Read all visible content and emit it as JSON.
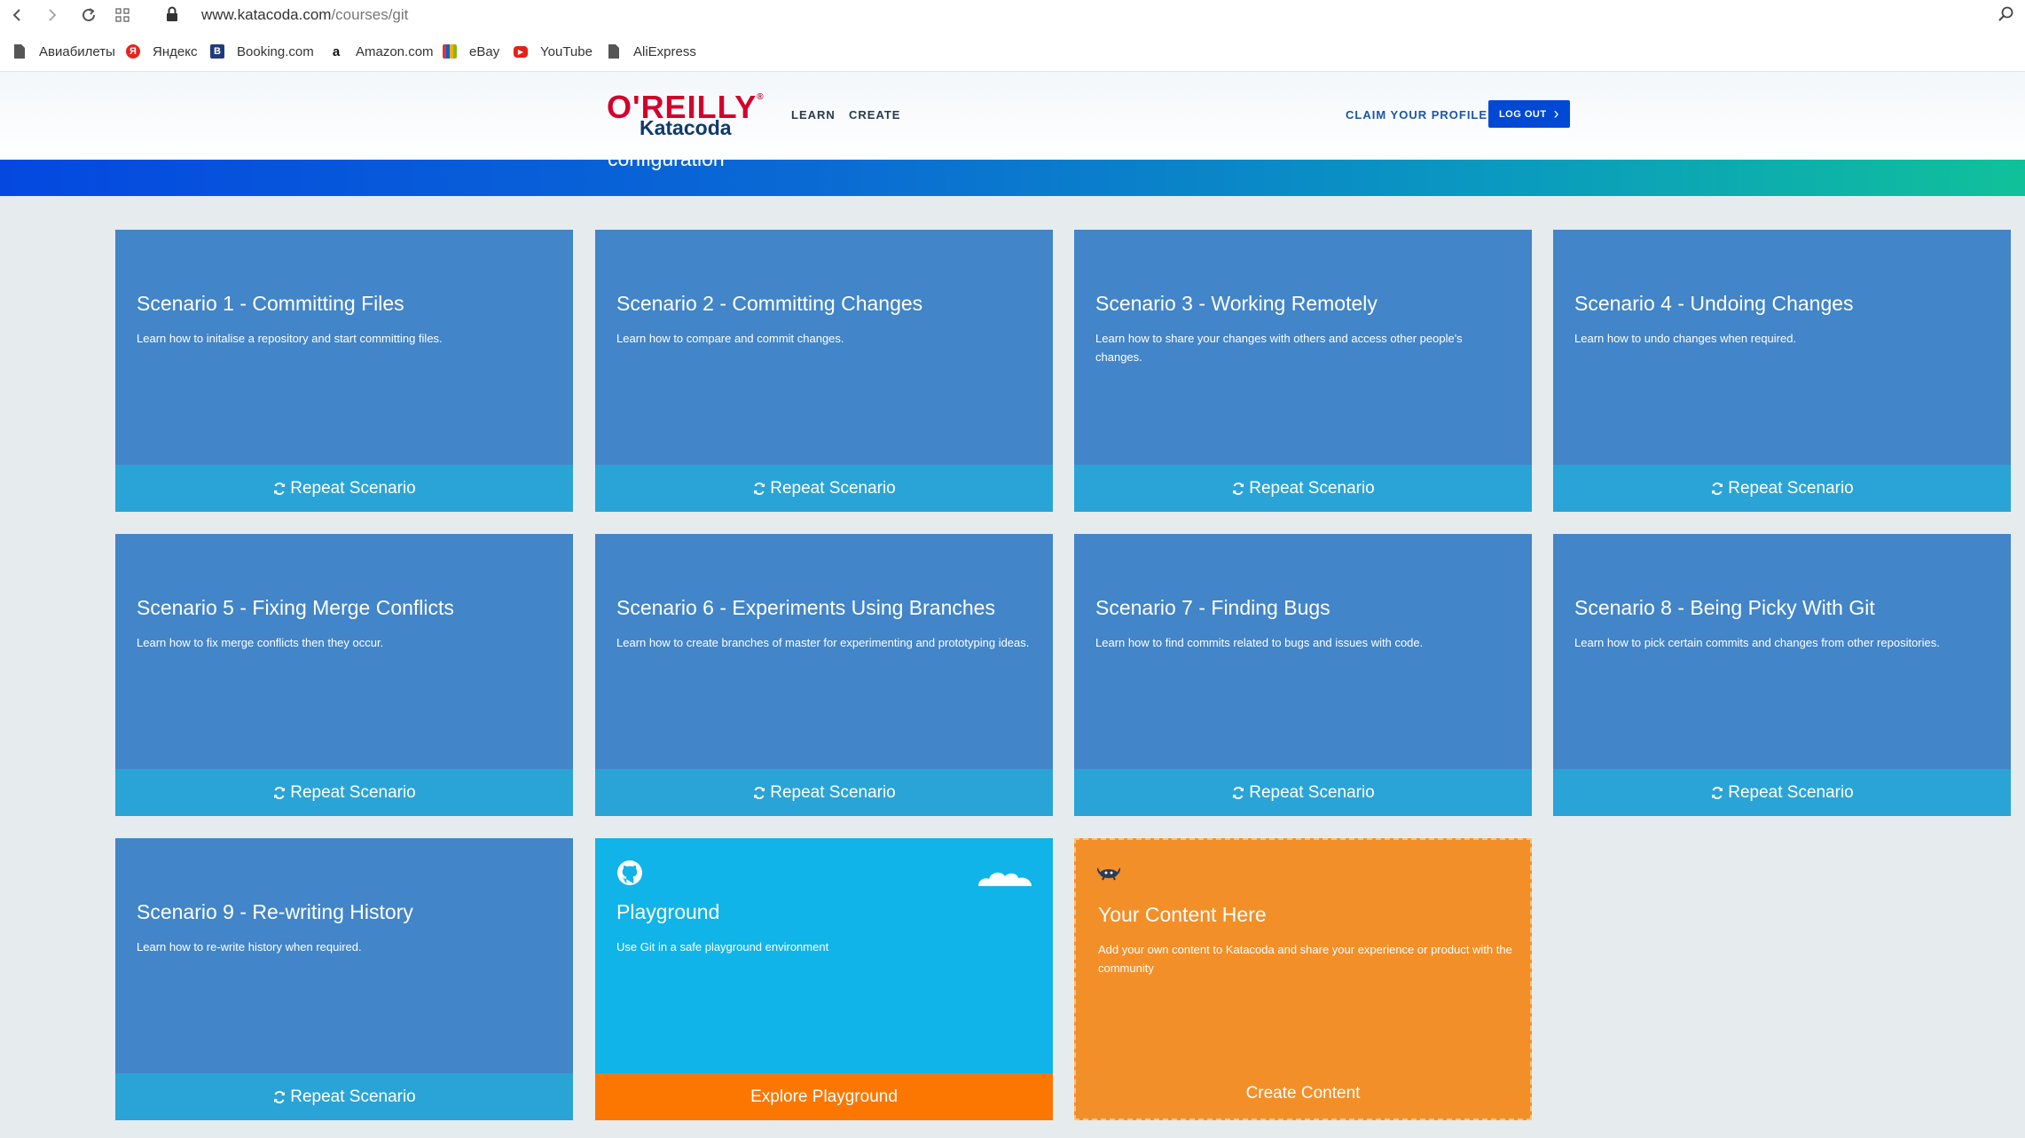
{
  "browser": {
    "url_domain": "www.katacoda.com",
    "url_path": "/courses/git",
    "bookmarks": [
      {
        "label": "Авиабилеты",
        "icon": "file-icon"
      },
      {
        "label": "Яндекс",
        "icon": "yandex-icon"
      },
      {
        "label": "Booking.com",
        "icon": "booking-icon"
      },
      {
        "label": "Amazon.com",
        "icon": "amazon-icon"
      },
      {
        "label": "eBay",
        "icon": "ebay-icon"
      },
      {
        "label": "YouTube",
        "icon": "youtube-icon"
      },
      {
        "label": "AliExpress",
        "icon": "file-icon"
      }
    ]
  },
  "header": {
    "logo_top": "O'REILLY",
    "logo_bottom": "Katacoda",
    "nav": [
      "LEARN",
      "CREATE"
    ],
    "claim": "CLAIM YOUR PROFILE",
    "logout": "LOG OUT"
  },
  "banner": {
    "text": "configuration"
  },
  "cards": [
    {
      "title": "Scenario 1 - Committing Files",
      "desc": "Learn how to initalise a repository and start committing files.",
      "action": "Repeat Scenario"
    },
    {
      "title": "Scenario 2 - Committing Changes",
      "desc": "Learn how to compare and commit changes.",
      "action": "Repeat Scenario"
    },
    {
      "title": "Scenario 3 - Working Remotely",
      "desc": "Learn how to share your changes with others and access other people's changes.",
      "action": "Repeat Scenario"
    },
    {
      "title": "Scenario 4 - Undoing Changes",
      "desc": "Learn how to undo changes when required.",
      "action": "Repeat Scenario"
    },
    {
      "title": "Scenario 5 - Fixing Merge Conflicts",
      "desc": "Learn how to fix merge conflicts then they occur.",
      "action": "Repeat Scenario"
    },
    {
      "title": "Scenario 6 - Experiments Using Branches",
      "desc": "Learn how to create branches of master for experimenting and prototyping ideas.",
      "action": "Repeat Scenario"
    },
    {
      "title": "Scenario 7 - Finding Bugs",
      "desc": "Learn how to find commits related to bugs and issues with code.",
      "action": "Repeat Scenario"
    },
    {
      "title": "Scenario 8 - Being Picky With Git",
      "desc": "Learn how to pick certain commits and changes from other repositories.",
      "action": "Repeat Scenario"
    },
    {
      "title": "Scenario 9 - Re-writing History",
      "desc": "Learn how to re-write history when required.",
      "action": "Repeat Scenario"
    }
  ],
  "playground": {
    "title": "Playground",
    "desc": "Use Git in a safe playground environment",
    "action": "Explore Playground"
  },
  "content": {
    "title": "Your Content Here",
    "desc": "Add your own content to Katacoda and share your experience or product with the community",
    "action": "Create Content"
  }
}
